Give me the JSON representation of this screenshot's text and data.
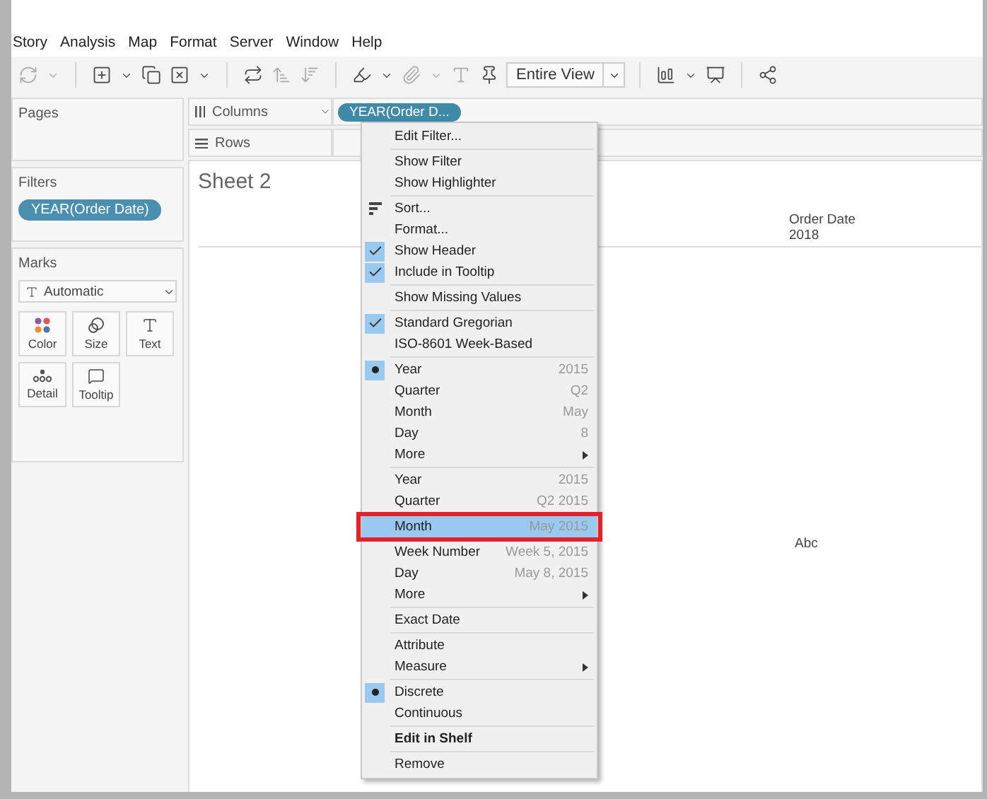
{
  "menubar": [
    "Story",
    "Analysis",
    "Map",
    "Format",
    "Server",
    "Window",
    "Help"
  ],
  "toolbar": {
    "fit_dropdown": "Entire View"
  },
  "sidebar": {
    "pages": {
      "title": "Pages"
    },
    "filters": {
      "title": "Filters",
      "pills": [
        "YEAR(Order Date)"
      ]
    },
    "marks": {
      "title": "Marks",
      "mark_type": "Automatic",
      "cards": [
        {
          "kind": "color",
          "label": "Color"
        },
        {
          "kind": "size",
          "label": "Size"
        },
        {
          "kind": "text",
          "label": "Text"
        },
        {
          "kind": "detail",
          "label": "Detail"
        },
        {
          "kind": "tooltip",
          "label": "Tooltip"
        }
      ]
    }
  },
  "shelves": [
    {
      "kind": "columns",
      "label": "Columns",
      "pills": [
        "YEAR(Order D..."
      ]
    },
    {
      "kind": "rows",
      "label": "Rows"
    }
  ],
  "sheet": {
    "title": "Sheet 2",
    "header_label": "Order Date",
    "header_value": "2018",
    "cell": "Abc"
  },
  "context_menu": {
    "sections": [
      {
        "items": [
          {
            "kind": "action",
            "label": "Edit Filter..."
          }
        ]
      },
      {
        "items": [
          {
            "kind": "action",
            "label": "Show Filter"
          },
          {
            "kind": "action",
            "label": "Show Highlighter"
          }
        ]
      },
      {
        "items": [
          {
            "kind": "sort",
            "label": "Sort..."
          },
          {
            "kind": "action",
            "label": "Format..."
          },
          {
            "kind": "check",
            "label": "Show Header",
            "checked": true
          },
          {
            "kind": "check",
            "label": "Include in Tooltip",
            "checked": true
          }
        ]
      },
      {
        "items": [
          {
            "kind": "action",
            "label": "Show Missing Values"
          }
        ]
      },
      {
        "items": [
          {
            "kind": "check",
            "label": "Standard Gregorian",
            "checked": true
          },
          {
            "kind": "check",
            "label": "ISO-8601 Week-Based",
            "checked": false
          }
        ]
      },
      {
        "items": [
          {
            "kind": "radio",
            "label": "Year",
            "value": "2015",
            "selected": true
          },
          {
            "kind": "radio",
            "label": "Quarter",
            "value": "Q2",
            "selected": false
          },
          {
            "kind": "radio",
            "label": "Month",
            "value": "May",
            "selected": false
          },
          {
            "kind": "radio",
            "label": "Day",
            "value": "8",
            "selected": false
          },
          {
            "kind": "submenu",
            "label": "More"
          }
        ]
      },
      {
        "items": [
          {
            "kind": "radio",
            "label": "Year",
            "value": "2015",
            "selected": false,
            "highlighted": false
          },
          {
            "kind": "radio",
            "label": "Quarter",
            "value": "Q2 2015",
            "selected": false,
            "highlighted": false
          },
          {
            "kind": "radio",
            "label": "Month",
            "value": "May 2015",
            "selected": false,
            "highlighted": true
          },
          {
            "kind": "radio",
            "label": "Week Number",
            "value": "Week 5, 2015",
            "selected": false,
            "highlighted": false
          },
          {
            "kind": "radio",
            "label": "Day",
            "value": "May 8, 2015",
            "selected": false,
            "highlighted": false
          },
          {
            "kind": "submenu",
            "label": "More",
            "highlighted": false
          }
        ]
      },
      {
        "items": [
          {
            "kind": "radio",
            "label": "Exact Date",
            "selected": false
          }
        ]
      },
      {
        "items": [
          {
            "kind": "radio",
            "label": "Attribute",
            "selected": false
          },
          {
            "kind": "submenu",
            "label": "Measure"
          }
        ]
      },
      {
        "items": [
          {
            "kind": "radio",
            "label": "Discrete",
            "selected": true
          },
          {
            "kind": "radio",
            "label": "Continuous",
            "selected": false
          }
        ]
      },
      {
        "items": [
          {
            "kind": "bold",
            "label": "Edit in Shelf"
          }
        ]
      },
      {
        "items": [
          {
            "kind": "action",
            "label": "Remove"
          }
        ]
      }
    ]
  }
}
